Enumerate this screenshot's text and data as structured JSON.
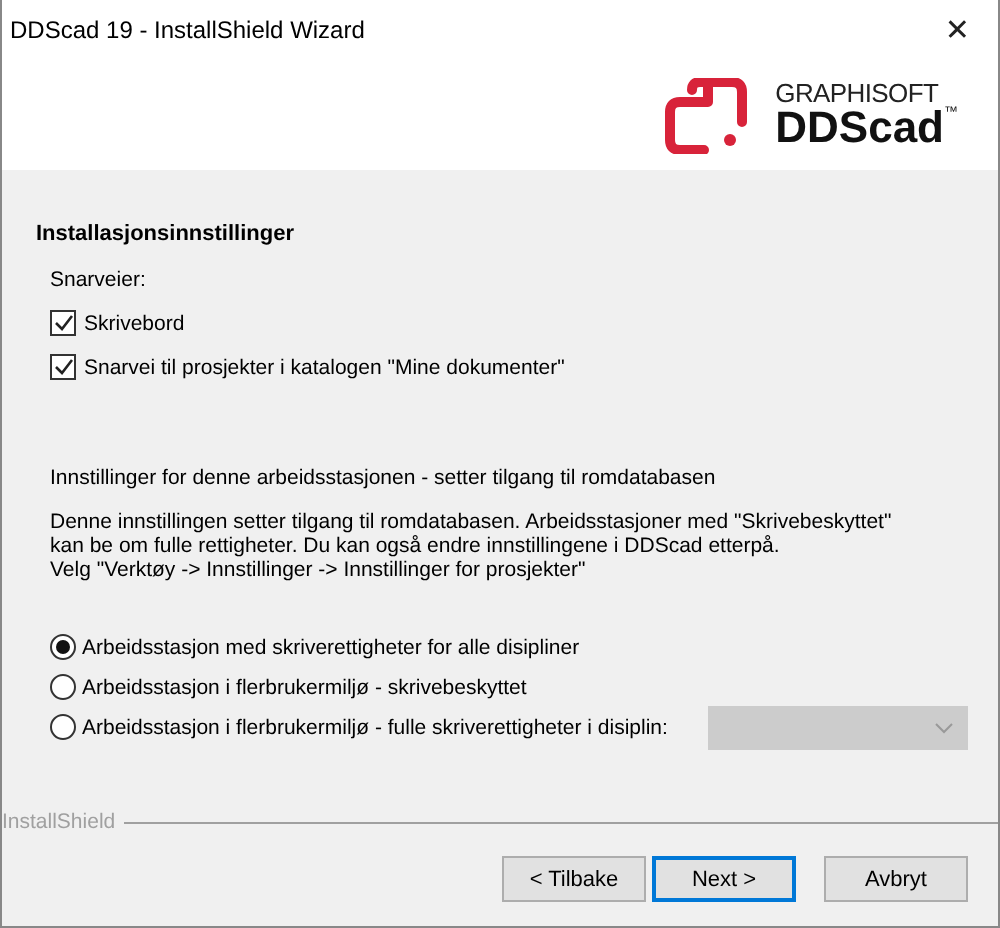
{
  "window": {
    "title": "DDScad 19 - InstallShield Wizard",
    "close": "✕"
  },
  "logo": {
    "brand": "GRAPHISOFT",
    "product": "DDScad",
    "mark": "™"
  },
  "heading": "Installasjonsinnstillinger",
  "shortcuts": {
    "label": "Snarveier:",
    "items": [
      {
        "label": "Skrivebord",
        "checked": true
      },
      {
        "label": "Snarvei til prosjekter i katalogen \"Mine dokumenter\"",
        "checked": true
      }
    ]
  },
  "workstation": {
    "title": "Innstillinger for denne arbeidsstasjonen - setter tilgang til romdatabasen",
    "description": [
      "Denne innstillingen setter tilgang til romdatabasen. Arbeidsstasjoner med \"Skrivebeskyttet\"",
      "kan be om fulle rettigheter. Du kan også endre innstillingene i DDScad etterpå.",
      "Velg \"Verktøy -> Innstillinger -> Innstillinger for prosjekter\""
    ],
    "options": [
      {
        "label": "Arbeidsstasjon med skriverettigheter for alle disipliner",
        "selected": true
      },
      {
        "label": "Arbeidsstasjon i flerbrukermiljø - skrivebeskyttet",
        "selected": false
      },
      {
        "label": "Arbeidsstasjon i flerbrukermiljø - fulle skriverettigheter i disiplin:",
        "selected": false
      }
    ],
    "discipline_dropdown": {
      "disabled": true
    }
  },
  "footer": {
    "brand": "InstallShield",
    "buttons": [
      {
        "label": "< Tilbake",
        "focused": false
      },
      {
        "label": "Next >",
        "focused": true
      },
      {
        "label": "Avbryt",
        "focused": false
      }
    ]
  }
}
